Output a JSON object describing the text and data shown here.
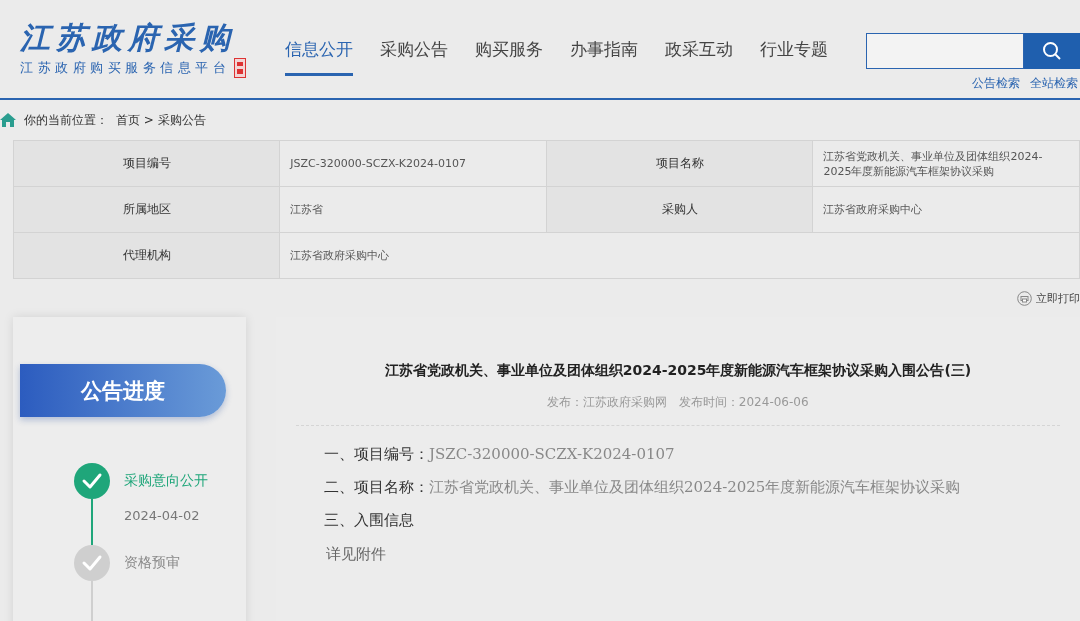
{
  "logo": {
    "title": "江苏政府采购",
    "subtitle": "江苏政府购买服务信息平台"
  },
  "nav": [
    {
      "label": "信息公开",
      "selected": true
    },
    {
      "label": "采购公告",
      "selected": false
    },
    {
      "label": "购买服务",
      "selected": false
    },
    {
      "label": "办事指南",
      "selected": false
    },
    {
      "label": "政采互动",
      "selected": false
    },
    {
      "label": "行业专题",
      "selected": false
    }
  ],
  "search": {
    "links": [
      "公告检索",
      "全站检索"
    ]
  },
  "breadcrumb": {
    "label": "你的当前位置：",
    "path": "首页 > 采购公告"
  },
  "info_table": [
    [
      {
        "label": "项目编号",
        "value": "JSZC-320000-SCZX-K2024-0107"
      },
      {
        "label": "项目名称",
        "value": "江苏省党政机关、事业单位及团体组织2024-2025年度新能源汽车框架协议采购"
      }
    ],
    [
      {
        "label": "所属地区",
        "value": "江苏省"
      },
      {
        "label": "采购人",
        "value": "江苏省政府采购中心"
      }
    ],
    [
      {
        "label": "代理机构",
        "value": "江苏省政府采购中心"
      }
    ]
  ],
  "print": "立即打印",
  "progress": {
    "title": "公告进度",
    "steps": [
      {
        "name": "采购意向公开",
        "date": "2024-04-02",
        "done": true
      },
      {
        "name": "资格预审",
        "done": false
      }
    ]
  },
  "article": {
    "title": "江苏省党政机关、事业单位及团体组织2024-2025年度新能源汽车框架协议采购入围公告(三)",
    "meta": "发布：江苏政府采购网   发布时间：2024-06-06",
    "paragraphs": [
      "**一、项目编号：**JSZC-320000-SCZX-K2024-0107",
      "**二、项目名称：**江苏省党政机关、事业单位及团体组织2024-2025年度新能源汽车框架协议采购",
      "**三、入围信息**"
    ],
    "note": "详见附件"
  }
}
